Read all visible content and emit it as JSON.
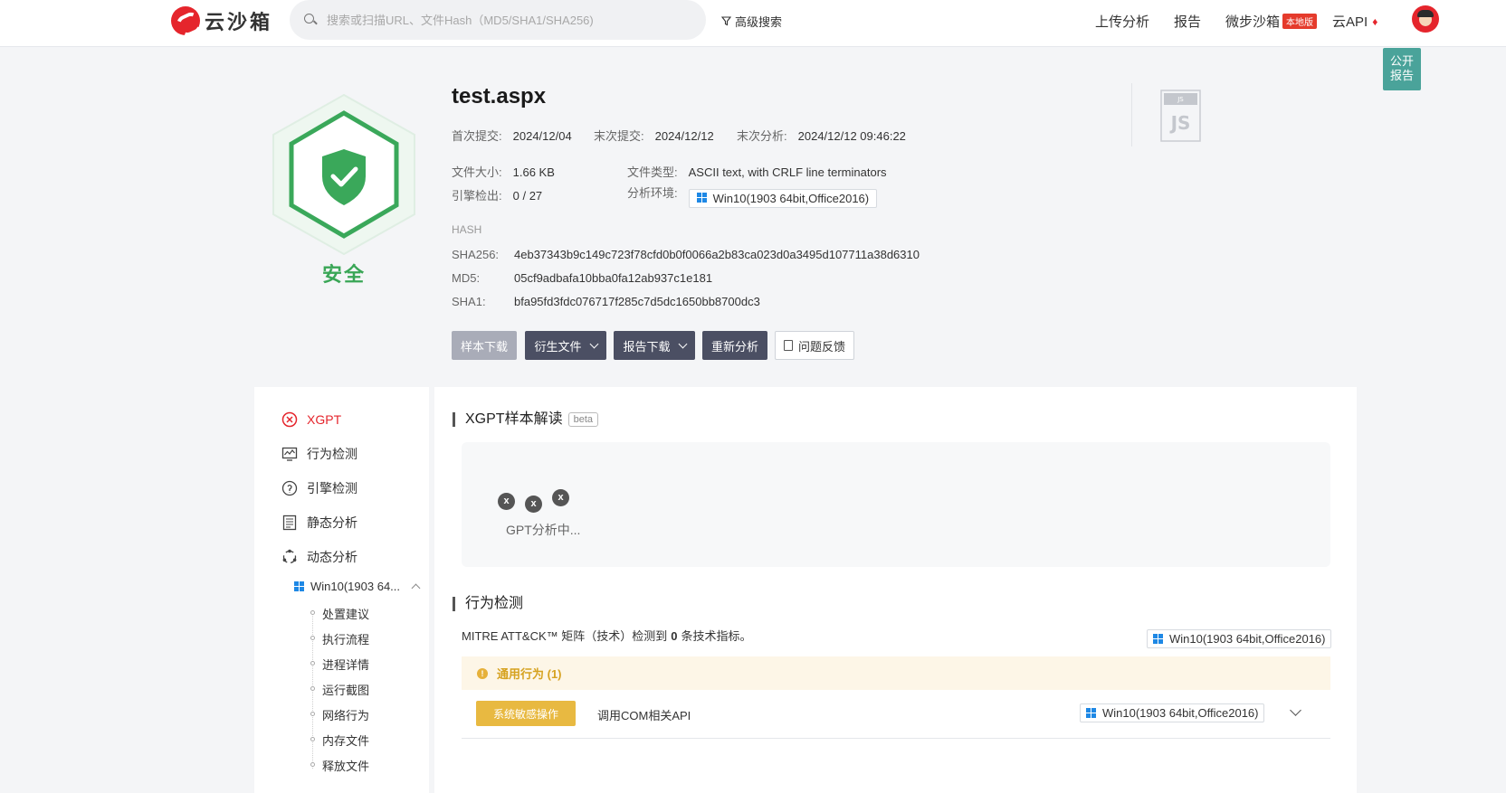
{
  "header": {
    "logo_text": "云沙箱",
    "search_placeholder": "搜索或扫描URL、文件Hash（MD5/SHA1/SHA256)",
    "advanced_search": "高级搜索",
    "nav": {
      "upload": "上传分析",
      "report": "报告",
      "micro_sandbox": "微步沙箱",
      "local_badge": "本地版",
      "cloud_api": "云API"
    },
    "public_report": [
      "公开",
      "报告"
    ]
  },
  "summary": {
    "status": "安全",
    "status_color": "#39a656",
    "file_name": "test.aspx",
    "first_submit_label": "首次提交:",
    "first_submit": "2024/12/04",
    "last_submit_label": "末次提交:",
    "last_submit": "2024/12/12",
    "last_analysis_label": "末次分析:",
    "last_analysis": "2024/12/12 09:46:22",
    "size_label": "文件大小:",
    "size": "1.66 KB",
    "type_label": "文件类型:",
    "type": "ASCII text, with CRLF line terminators",
    "engine_label": "引擎检出:",
    "engine": "0 / 27",
    "env_label": "分析环境:",
    "env": "Win10(1903 64bit,Office2016)",
    "hash_title": "HASH",
    "sha256_label": "SHA256:",
    "sha256": "4eb37343b9c149c723f78cfd0b0f0066a2b83ca023d0a3495d107711a38d6310",
    "md5_label": "MD5:",
    "md5": "05cf9adbafa10bba0fa12ab937c1e181",
    "sha1_label": "SHA1:",
    "sha1": "bfa95fd3fdc076717f285c7d5dc1650bb8700dc3",
    "file_icon_big": "JS",
    "file_icon_small": "JS"
  },
  "actions": {
    "download_sample": "样本下载",
    "derived_files": "衍生文件",
    "report_download": "报告下载",
    "reanalyze": "重新分析",
    "feedback": "问题反馈"
  },
  "sidebar": {
    "items": [
      "XGPT",
      "行为检测",
      "引擎检测",
      "静态分析",
      "动态分析"
    ],
    "env": "Win10(1903 64...",
    "sub_items": [
      "处置建议",
      "执行流程",
      "进程详情",
      "运行截图",
      "网络行为",
      "内存文件",
      "释放文件"
    ]
  },
  "xgpt": {
    "title": "XGPT样本解读",
    "beta": "beta",
    "loading": "GPT分析中...",
    "loader_glyph": "x"
  },
  "behavior": {
    "title": "行为检测",
    "mitre_prefix": "MITRE ATT&CK™ 矩阵（技术）检测到",
    "mitre_count": "0",
    "mitre_suffix": "条技术指标。",
    "env": "Win10(1903 64bit,Office2016)",
    "general": "通用行为 (1)",
    "row_tag": "系统敏感操作",
    "row_text": "调用COM相关API",
    "row_env": "Win10(1903 64bit,Office2016)"
  }
}
